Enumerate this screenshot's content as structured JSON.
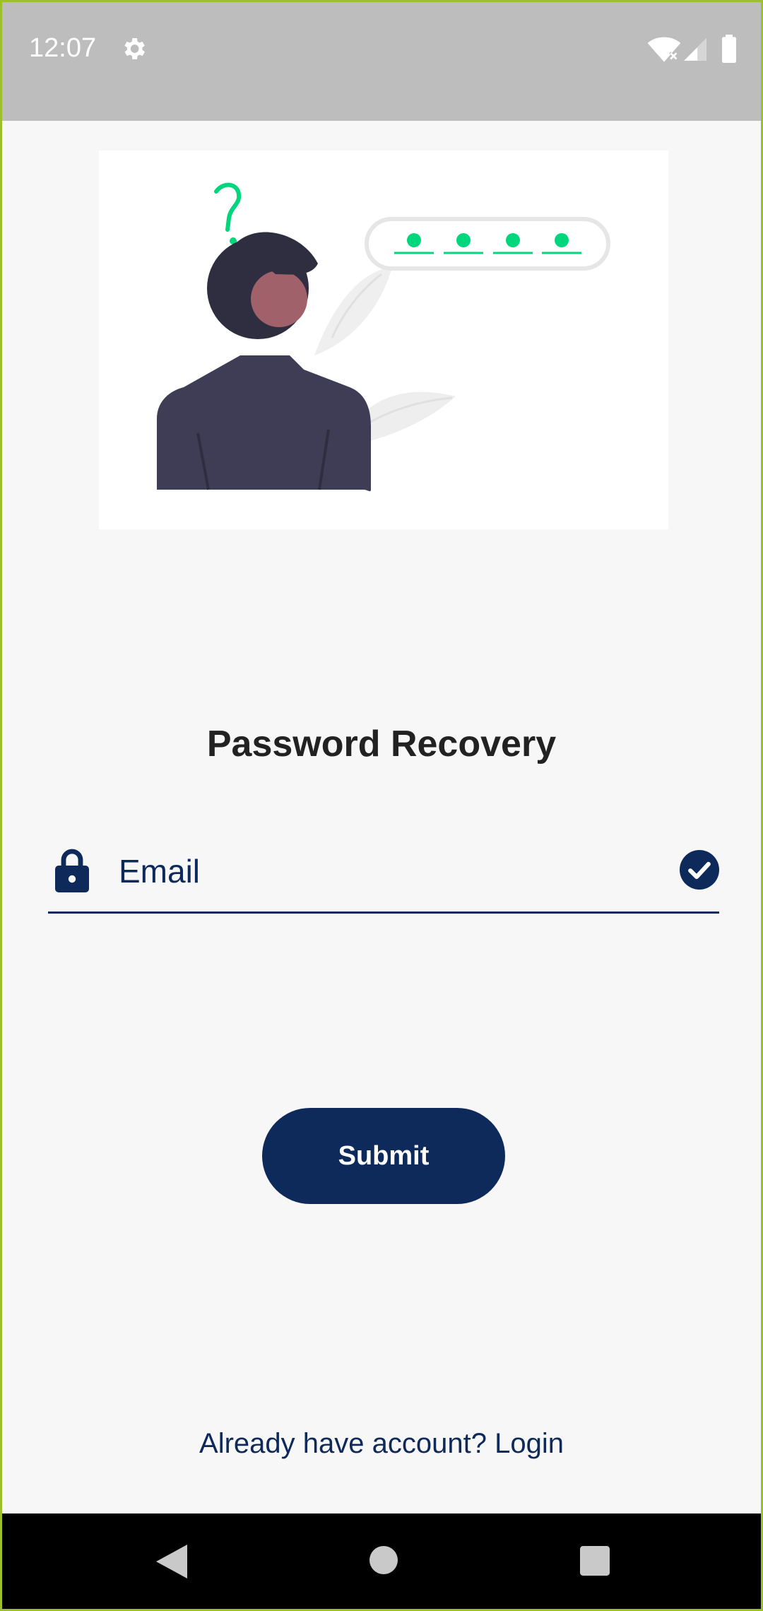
{
  "status_bar": {
    "time": "12:07",
    "icons": [
      "settings-gear-icon",
      "wifi-off-icon",
      "cell-signal-icon",
      "battery-icon"
    ]
  },
  "hero": {
    "icon": "forgot-password-illustration",
    "colors": {
      "accent": "#00d67b",
      "hair": "#2f2e41",
      "skin": "#a0616a",
      "jacket": "#3f3d56"
    }
  },
  "page": {
    "title": "Password Recovery"
  },
  "email_field": {
    "value": "",
    "placeholder": "Email",
    "leading_icon": "lock-icon",
    "trailing_icon": "check-circle-icon"
  },
  "submit_button": {
    "label": "Submit"
  },
  "login_link": {
    "label": "Already have account? Login"
  },
  "nav_bar": {
    "icons": [
      "back-icon",
      "home-icon",
      "recents-icon"
    ]
  },
  "colors": {
    "primary": "#0e2a5a",
    "background": "#f7f7f8",
    "status_bar": "#bdbdbd",
    "frame": "#9dbf2c"
  }
}
